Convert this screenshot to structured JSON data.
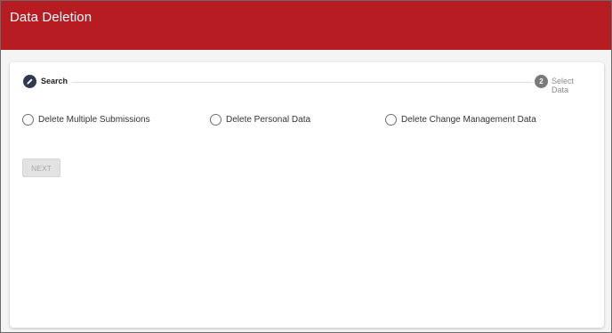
{
  "header": {
    "title": "Data Deletion"
  },
  "colors": {
    "header_bg": "#b71c22",
    "active_step": "#2f3a4f",
    "inactive_step": "#7a7a7a"
  },
  "stepper": {
    "steps": [
      {
        "icon": "pencil-icon",
        "label": "Search",
        "state": "active"
      },
      {
        "number": "2",
        "label": "Select Data",
        "state": "inactive"
      }
    ]
  },
  "options": [
    {
      "label": "Delete Multiple Submissions",
      "selected": false
    },
    {
      "label": "Delete Personal Data",
      "selected": false
    },
    {
      "label": "Delete Change Management Data",
      "selected": false
    }
  ],
  "next_button": {
    "label": "NEXT",
    "disabled": true
  }
}
